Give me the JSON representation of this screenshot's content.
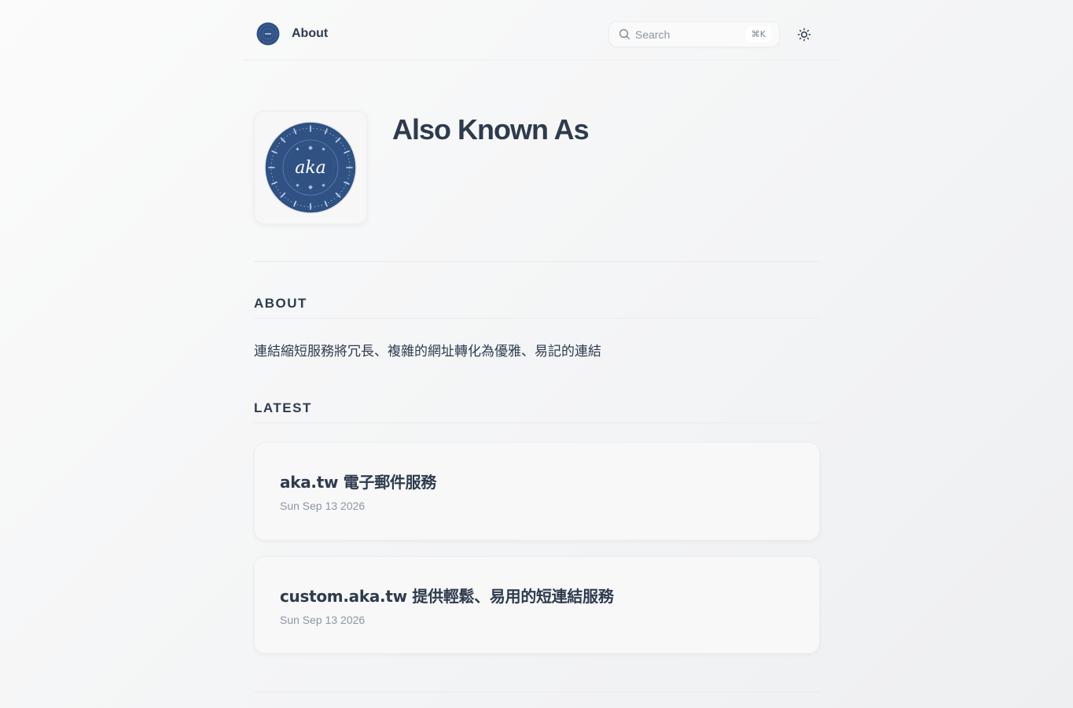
{
  "header": {
    "nav_about": "About",
    "search_placeholder": "Search",
    "search_shortcut": "⌘K"
  },
  "hero": {
    "title": "Also Known As",
    "logo_text": "aka"
  },
  "about": {
    "heading": "ABOUT",
    "description": "連結縮短服務將冗長、複雜的網址轉化為優雅、易記的連結"
  },
  "latest": {
    "heading": "LATEST",
    "posts": [
      {
        "title": "aka.tw 電子郵件服務",
        "date": "Sun Sep 13 2026"
      },
      {
        "title": "custom.aka.tw 提供輕鬆、易用的短連結服務",
        "date": "Sun Sep 13 2026"
      }
    ]
  },
  "colors": {
    "text": "#2e3b4e",
    "muted": "#8d96a3",
    "logo_blue": "#2f5183"
  },
  "icons": {
    "search": "search-icon",
    "theme": "sun-icon",
    "logo": "aka-logo-icon"
  }
}
